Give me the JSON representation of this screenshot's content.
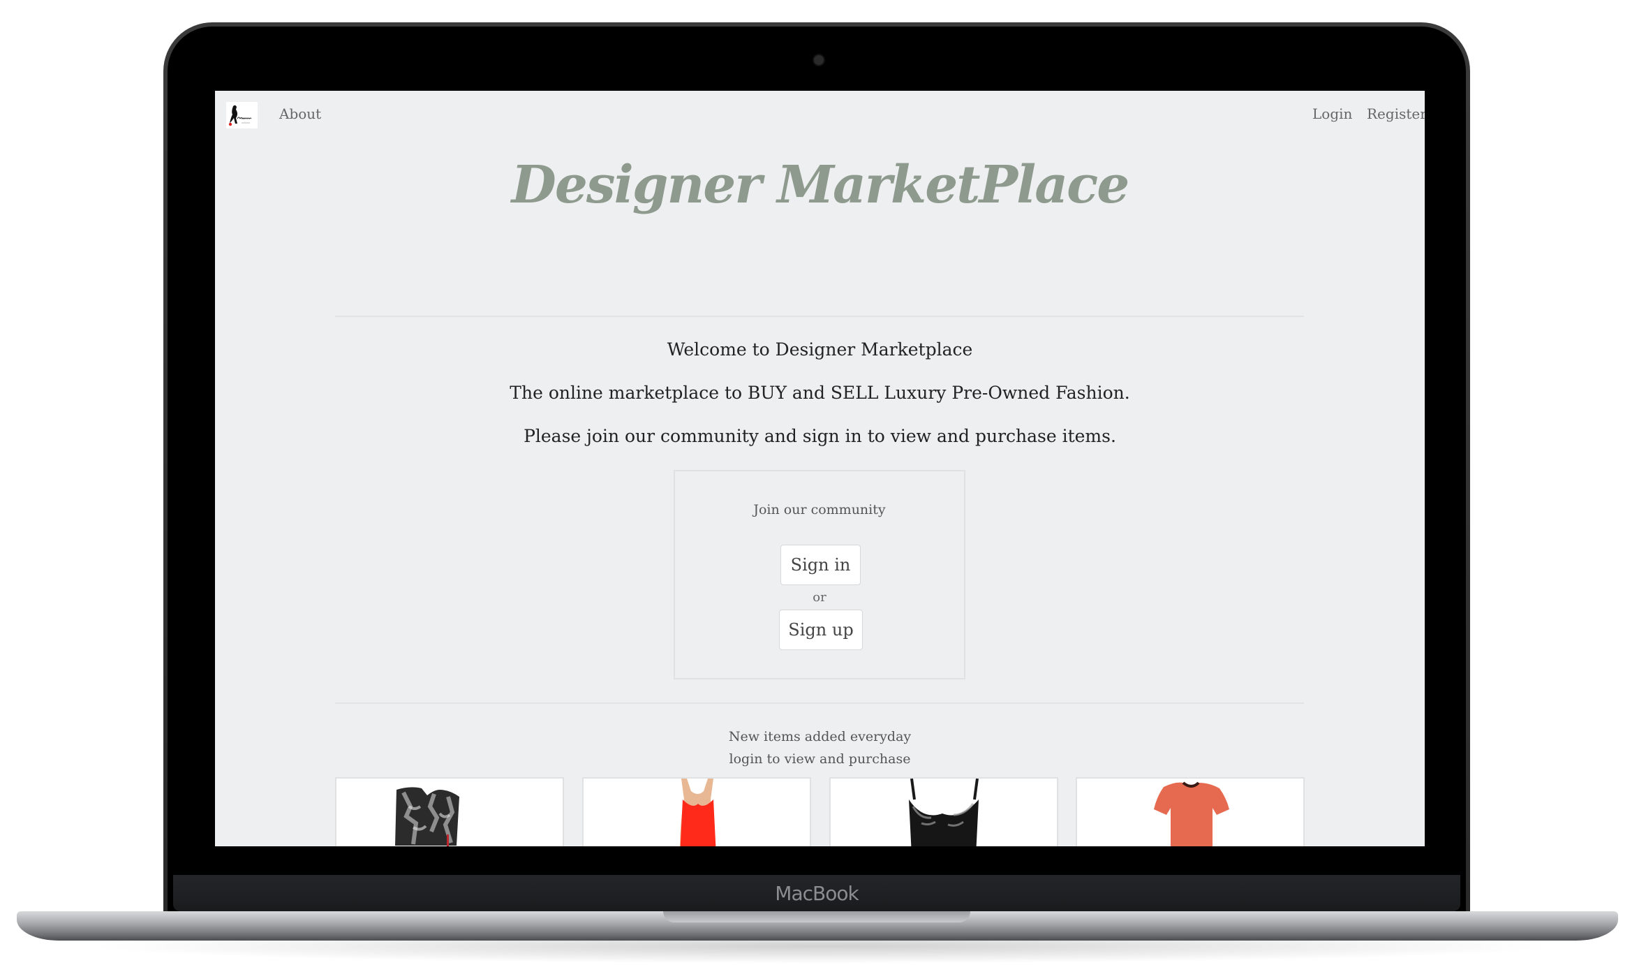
{
  "device": {
    "brand_label": "MacBook"
  },
  "nav": {
    "about": "About",
    "login": "Login",
    "register": "Register"
  },
  "site_title": "Designer MarketPlace",
  "welcome": {
    "line1": "Welcome to Designer Marketplace",
    "line2": "The online marketplace to BUY and SELL Luxury Pre-Owned Fashion.",
    "line3": "Please join our community and sign in to view and purchase items."
  },
  "join": {
    "title": "Join our community",
    "sign_in": "Sign in",
    "or": "or",
    "sign_up": "Sign up"
  },
  "new_items": {
    "line1": "New items added everyday",
    "line2": "login to view and purchase"
  },
  "colors": {
    "page_background": "#eeeff1",
    "title_color": "#8e9a8e",
    "item_dress_red": "#ff2a1a",
    "item_top_coral": "#e66a4f"
  }
}
